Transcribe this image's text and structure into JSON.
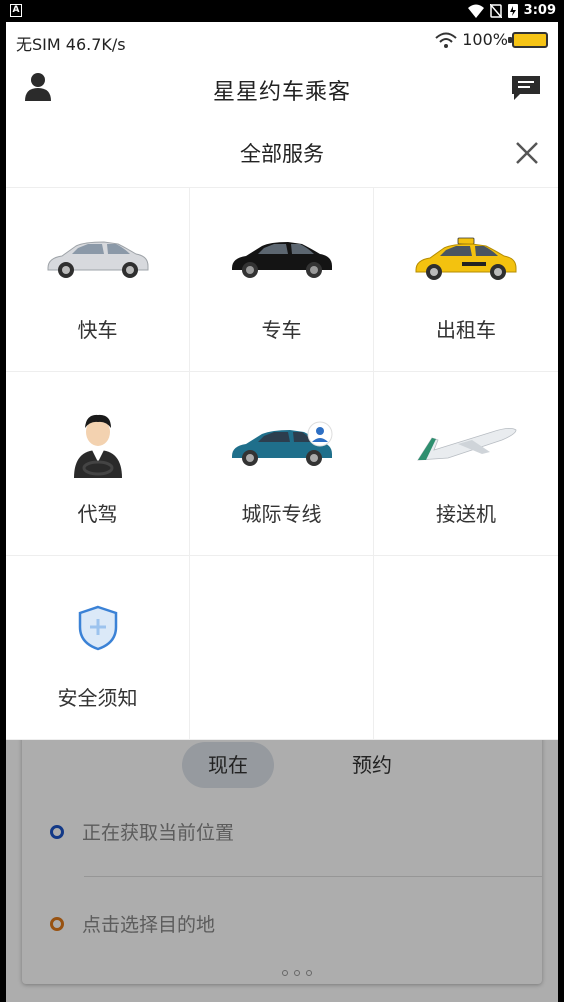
{
  "system_bar": {
    "time": "3:09"
  },
  "status": {
    "carrier": "无SIM",
    "speed": "46.7K/s",
    "battery": "100%"
  },
  "header": {
    "title": "星星约车乘客"
  },
  "panel": {
    "title": "全部服务",
    "services": [
      {
        "label": "快车",
        "icon": "silver-car-icon"
      },
      {
        "label": "专车",
        "icon": "black-car-icon"
      },
      {
        "label": "出租车",
        "icon": "taxi-icon"
      },
      {
        "label": "代驾",
        "icon": "driver-icon"
      },
      {
        "label": "城际专线",
        "icon": "intercity-car-icon"
      },
      {
        "label": "接送机",
        "icon": "airplane-icon"
      },
      {
        "label": "安全须知",
        "icon": "shield-icon"
      }
    ]
  },
  "home": {
    "tab_now": "现在",
    "tab_later": "预约",
    "origin_placeholder": "正在获取当前位置",
    "destination_placeholder": "点击选择目的地"
  },
  "colors": {
    "battery": "#f6c416",
    "origin_dot": "#1d55c7",
    "destination_dot": "#e07a1a"
  }
}
